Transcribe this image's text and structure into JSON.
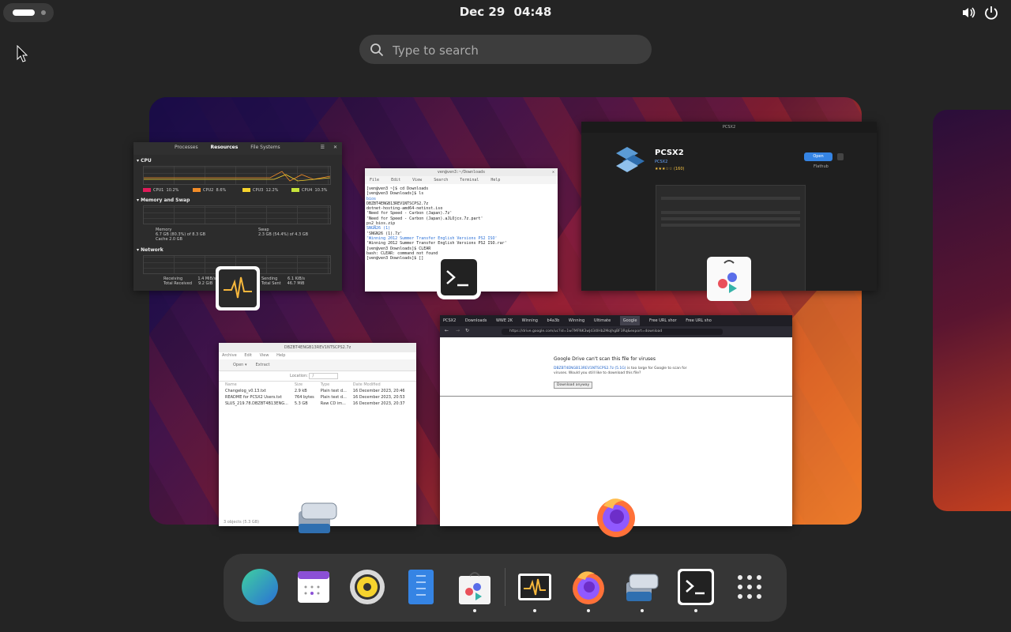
{
  "topbar": {
    "date": "Dec 29",
    "time": "04:48",
    "icons": [
      "volume-icon",
      "power-icon"
    ]
  },
  "search": {
    "placeholder": "Type to search"
  },
  "windows": {
    "system_monitor": {
      "tabs": [
        "Processes",
        "Resources",
        "File Systems"
      ],
      "active_tab": "Resources",
      "cpu_label": "CPU",
      "cpus": [
        {
          "name": "CPU1",
          "value": "10.2%",
          "color": "#e01b5a"
        },
        {
          "name": "CPU2",
          "value": "8.6%",
          "color": "#f28c28"
        },
        {
          "name": "CPU3",
          "value": "12.2%",
          "color": "#f6d32d"
        },
        {
          "name": "CPU4",
          "value": "10.3%",
          "color": "#c6e33a"
        }
      ],
      "memory_label": "Memory and Swap",
      "memory_title": "Memory",
      "memory_value": "6.7 GB (80.3%) of 8.3 GB",
      "cache_value": "Cache 2.0 GB",
      "swap_title": "Swap",
      "swap_value": "2.3 GB (54.4%) of 4.3 GB",
      "network_label": "Network",
      "receiving_label": "Receiving",
      "receiving_value": "1.4 MiB/s",
      "total_received_label": "Total Received",
      "total_received_value": "9.2 GiB",
      "sending_label": "Sending",
      "sending_value": "6.1 KiB/s",
      "total_sent_label": "Total Sent",
      "total_sent_value": "46.7 MiB"
    },
    "terminal": {
      "title": "ven@ven3:~/Downloads",
      "menu": [
        "File",
        "Edit",
        "View",
        "Search",
        "Terminal",
        "Help"
      ],
      "lines": [
        "[ven@ven3 ~]$ cd Downloads",
        "[ven@ven3 Downloads]$ ls",
        "bios",
        "DBZBT4ENGB13REV1NTSCPS2.7z",
        "dotnet-hosting-amd64-netinst.iso",
        "'Need for Speed - Carbon (Japan).7z'",
        "'Need for Speed - Carbon (Japan).aJLOjcx.7z.part'",
        "ps2_bios.zip",
        "SNGN26 (1)",
        "'SNGN26 (1).7z'",
        "'Winning 2012 Summer Transfer English Versions PS2 ISO'",
        "'Winning 2012 Summer Transfer English Versions PS2 ISO.rar'",
        "[ven@ven3 Downloads]$ CLEAR",
        "bash: CLEAR: command not found",
        "[ven@ven3 Downloads]$ []"
      ]
    },
    "store": {
      "window_title": "PCSX2",
      "app_name": "PCSX2",
      "developer": "PCSX2",
      "rating": "★★★☆☆ (160)",
      "open_label": "Open",
      "source": "Flathub"
    },
    "archive": {
      "title": "DBZBT4ENGB13REV1NTSCPS2.7z",
      "menu": [
        "Archive",
        "Edit",
        "View",
        "Help"
      ],
      "toolbar": [
        "Open",
        "Extract"
      ],
      "location_label": "Location:",
      "location_value": "/",
      "columns": [
        "Name",
        "Size",
        "Type",
        "Date Modified"
      ],
      "rows": [
        {
          "name": "Changelog_v0.13.txt",
          "size": "2.9 kB",
          "type": "Plain text d...",
          "date": "16 December 2023, 20:46"
        },
        {
          "name": "README for PCSX2 Users.txt",
          "size": "764 bytes",
          "type": "Plain text d...",
          "date": "16 December 2023, 20:53"
        },
        {
          "name": "SLUS_219.78.DBZBT4B13ENG...",
          "size": "5.3 GB",
          "type": "Raw CD im...",
          "date": "16 December 2023, 20:37"
        }
      ],
      "status": "3 objects (5.3 GB)"
    },
    "firefox": {
      "tabs": [
        "PCSX2",
        "Downloads",
        "WWE 2K",
        "Winning",
        "b4a3b",
        "Winning",
        "Ultimate",
        "Google",
        "Free URL shor",
        "Free URL sho"
      ],
      "active_tab": "Google",
      "url": "https://drive.google.com/uc?id=1w7MFNK3wJd34IHb2MoJhgBF3Rq&export=download",
      "heading": "Google Drive can't scan this file for viruses",
      "message_link": "DBZBT4ENGB13REV1NTSCPS2.7z (5.1G)",
      "message_rest": " is too large for Google to scan for viruses. Would you still like to download this file?",
      "button": "Download anyway"
    }
  },
  "dash": {
    "apps": [
      {
        "name": "browser-globe-icon",
        "running": false
      },
      {
        "name": "calendar-icon",
        "running": false
      },
      {
        "name": "rhythmbox-icon",
        "running": false
      },
      {
        "name": "text-editor-icon",
        "running": false
      },
      {
        "name": "software-store-icon",
        "running": true
      },
      {
        "name": "system-monitor-icon",
        "running": true
      },
      {
        "name": "firefox-icon",
        "running": true
      },
      {
        "name": "file-roller-icon",
        "running": true
      },
      {
        "name": "terminal-icon",
        "running": true
      },
      {
        "name": "app-grid-icon",
        "running": false
      }
    ]
  }
}
